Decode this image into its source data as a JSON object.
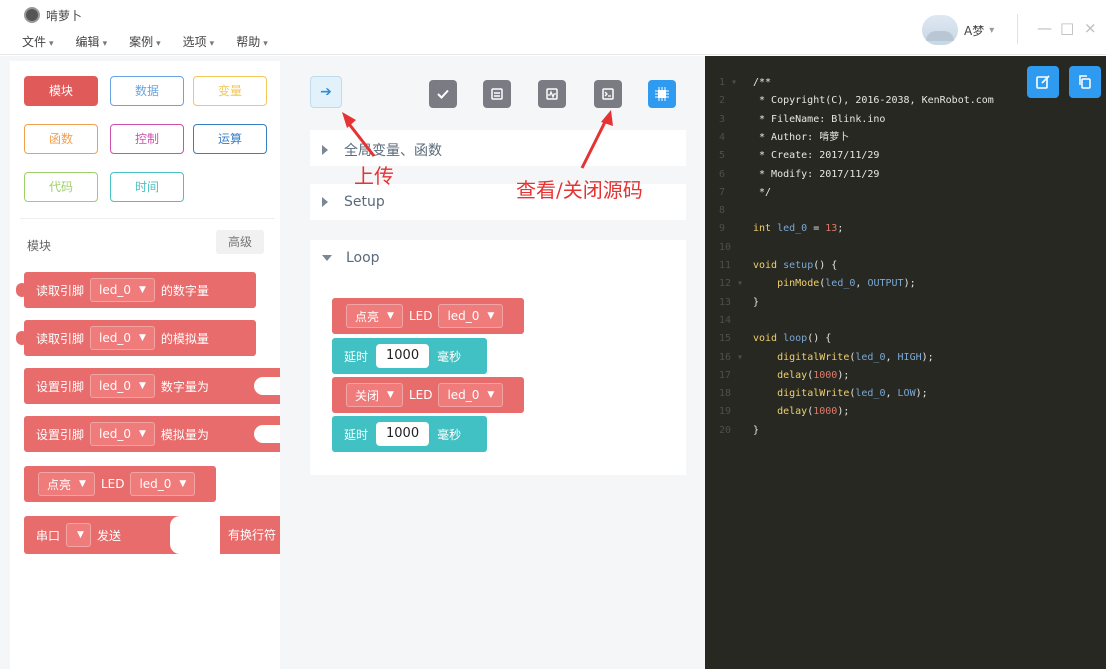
{
  "window": {
    "title": "啃萝卜",
    "menu": [
      "文件",
      "编辑",
      "案例",
      "选项",
      "帮助"
    ],
    "user_name": "A梦",
    "controls": [
      "—",
      "□",
      "×"
    ]
  },
  "categories": [
    {
      "label": "模块",
      "color": "#e05a5a",
      "active": true
    },
    {
      "label": "数据",
      "color": "#6aa4e0",
      "active": false
    },
    {
      "label": "变量",
      "color": "#f3c75a",
      "active": false
    },
    {
      "label": "函数",
      "color": "#f0a050",
      "active": false
    },
    {
      "label": "控制",
      "color": "#d04fae",
      "active": false
    },
    {
      "label": "运算",
      "color": "#3a7fc6",
      "active": false
    },
    {
      "label": "代码",
      "color": "#9fcf6a",
      "active": false
    },
    {
      "label": "时间",
      "color": "#48c2c4",
      "active": false
    }
  ],
  "palette": {
    "section_label": "模块",
    "advanced_label": "高级",
    "blocks": [
      {
        "pre": "读取引脚",
        "dd": "led_0",
        "post": "的数字量"
      },
      {
        "pre": "读取引脚",
        "dd": "led_0",
        "post": "的模拟量"
      },
      {
        "pre": "设置引脚",
        "dd": "led_0",
        "post": "数字量为"
      },
      {
        "pre": "设置引脚",
        "dd": "led_0",
        "post": "模拟量为"
      },
      {
        "dd1": "点亮",
        "mid": "LED",
        "dd2": "led_0"
      },
      {
        "pre": "串口",
        "dd": "",
        "mid": "发送",
        "post": "有换行符"
      }
    ]
  },
  "workspace": {
    "sections": [
      "全局变量、函数",
      "Setup",
      "Loop"
    ],
    "loop_blocks": [
      {
        "kind": "led",
        "action": "点亮",
        "label": "LED",
        "pin": "led_0"
      },
      {
        "kind": "delay",
        "pre": "延时",
        "value": "1000",
        "unit": "毫秒"
      },
      {
        "kind": "led",
        "action": "关闭",
        "label": "LED",
        "pin": "led_0"
      },
      {
        "kind": "delay",
        "pre": "延时",
        "value": "1000",
        "unit": "毫秒"
      }
    ],
    "annotations": {
      "upload": "上传",
      "toggle_source": "查看/关闭源码"
    },
    "accent": "#e53333"
  },
  "code": {
    "lines": [
      {
        "n": "1",
        "fold": true,
        "t": "/**"
      },
      {
        "n": "2",
        "t": " * Copyright(C), 2016-2038, KenRobot.com"
      },
      {
        "n": "3",
        "t": " * FileName: Blink.ino"
      },
      {
        "n": "4",
        "t": " * Author: 啃萝卜"
      },
      {
        "n": "5",
        "t": " * Create: 2017/11/29"
      },
      {
        "n": "6",
        "t": " * Modify: 2017/11/29"
      },
      {
        "n": "7",
        "t": " */"
      },
      {
        "n": "8",
        "t": ""
      },
      {
        "n": "9",
        "t": "int led_0 = 13;"
      },
      {
        "n": "10",
        "t": ""
      },
      {
        "n": "11",
        "t": "void setup() {"
      },
      {
        "n": "12",
        "fold": true,
        "t": "    pinMode(led_0, OUTPUT);"
      },
      {
        "n": "13",
        "t": "}"
      },
      {
        "n": "14",
        "t": ""
      },
      {
        "n": "15",
        "t": "void loop() {"
      },
      {
        "n": "16",
        "fold": true,
        "t": "    digitalWrite(led_0, HIGH);"
      },
      {
        "n": "17",
        "t": "    delay(1000);"
      },
      {
        "n": "18",
        "t": "    digitalWrite(led_0, LOW);"
      },
      {
        "n": "19",
        "t": "    delay(1000);"
      },
      {
        "n": "20",
        "t": "}"
      }
    ]
  },
  "colors": {
    "block_red": "#e86c6c",
    "block_teal": "#41c1c4",
    "tool_gray": "#7b7b84",
    "code_bg": "#272822",
    "accent_blue": "#2e9af0"
  }
}
